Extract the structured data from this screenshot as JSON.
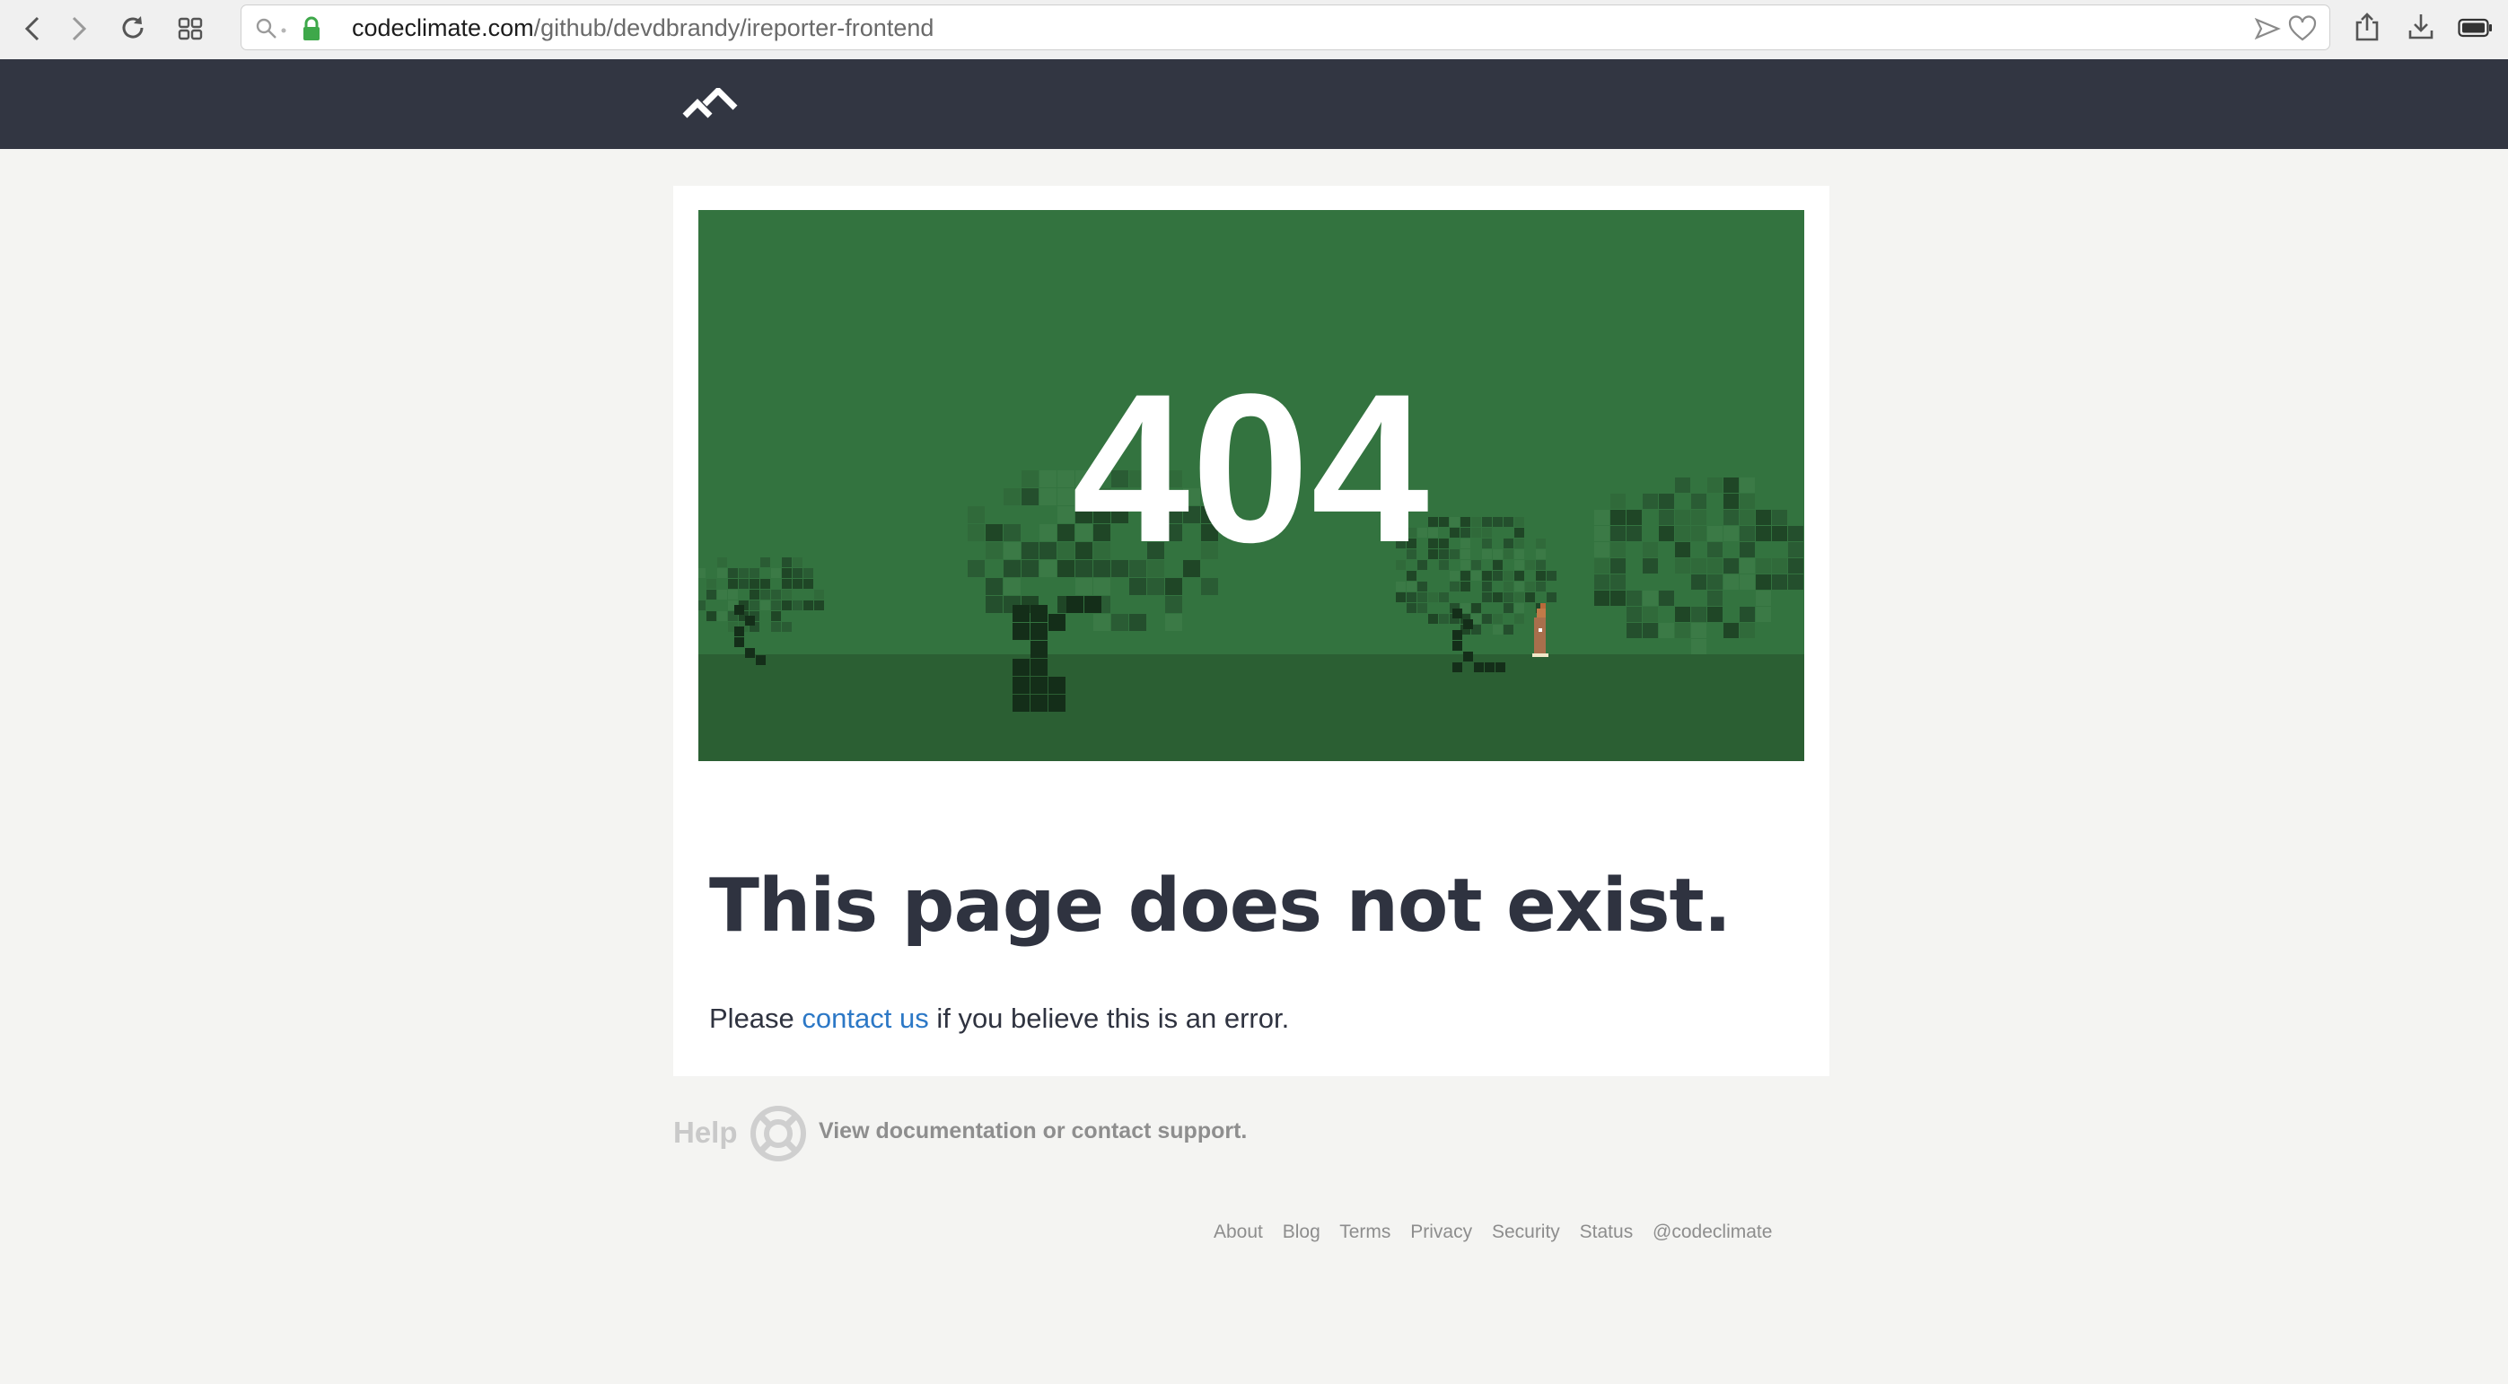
{
  "browser": {
    "url_host": "codeclimate.com",
    "url_path": "/github/devdbrandy/ireporter-frontend"
  },
  "error": {
    "code": "404",
    "headline": "This page does not exist.",
    "message_before": "Please ",
    "contact_link": "contact us",
    "message_after": " if you believe this is an error."
  },
  "help": {
    "label": "Help",
    "text": "View documentation or contact support."
  },
  "footer": {
    "links": [
      "About",
      "Blog",
      "Terms",
      "Privacy",
      "Security",
      "Status",
      "@codeclimate"
    ]
  },
  "colors": {
    "header_bg": "#323642",
    "scene_sky": "#33733f",
    "scene_ground": "#2b5f33",
    "link": "#2c78c6"
  }
}
